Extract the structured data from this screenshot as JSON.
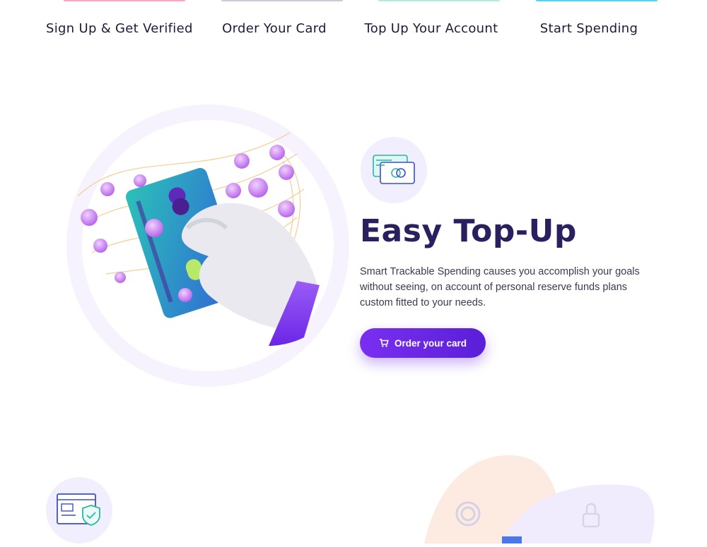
{
  "steps": [
    {
      "label": "Sign Up & Get Verified",
      "color": "#f7a6c8"
    },
    {
      "label": "Order Your Card",
      "color": "#c9cbd6"
    },
    {
      "label": "Top Up Your Account",
      "color": "#b8e8e0"
    },
    {
      "label": "Start Spending",
      "color": "#5fd0e8"
    }
  ],
  "feature": {
    "icon": "credit-card-icon",
    "title": "Easy Top-Up",
    "description": "Smart Trackable Spending causes you accomplish your goals without seeing, on account of personal reserve funds plans custom fitted to your needs.",
    "button_label": "Order your card",
    "button_icon": "cart-icon"
  },
  "next_section": {
    "icon": "browser-security-icon"
  },
  "colors": {
    "accent": "#6a26e6",
    "title": "#2a2060",
    "coin": "#c26cf0"
  }
}
